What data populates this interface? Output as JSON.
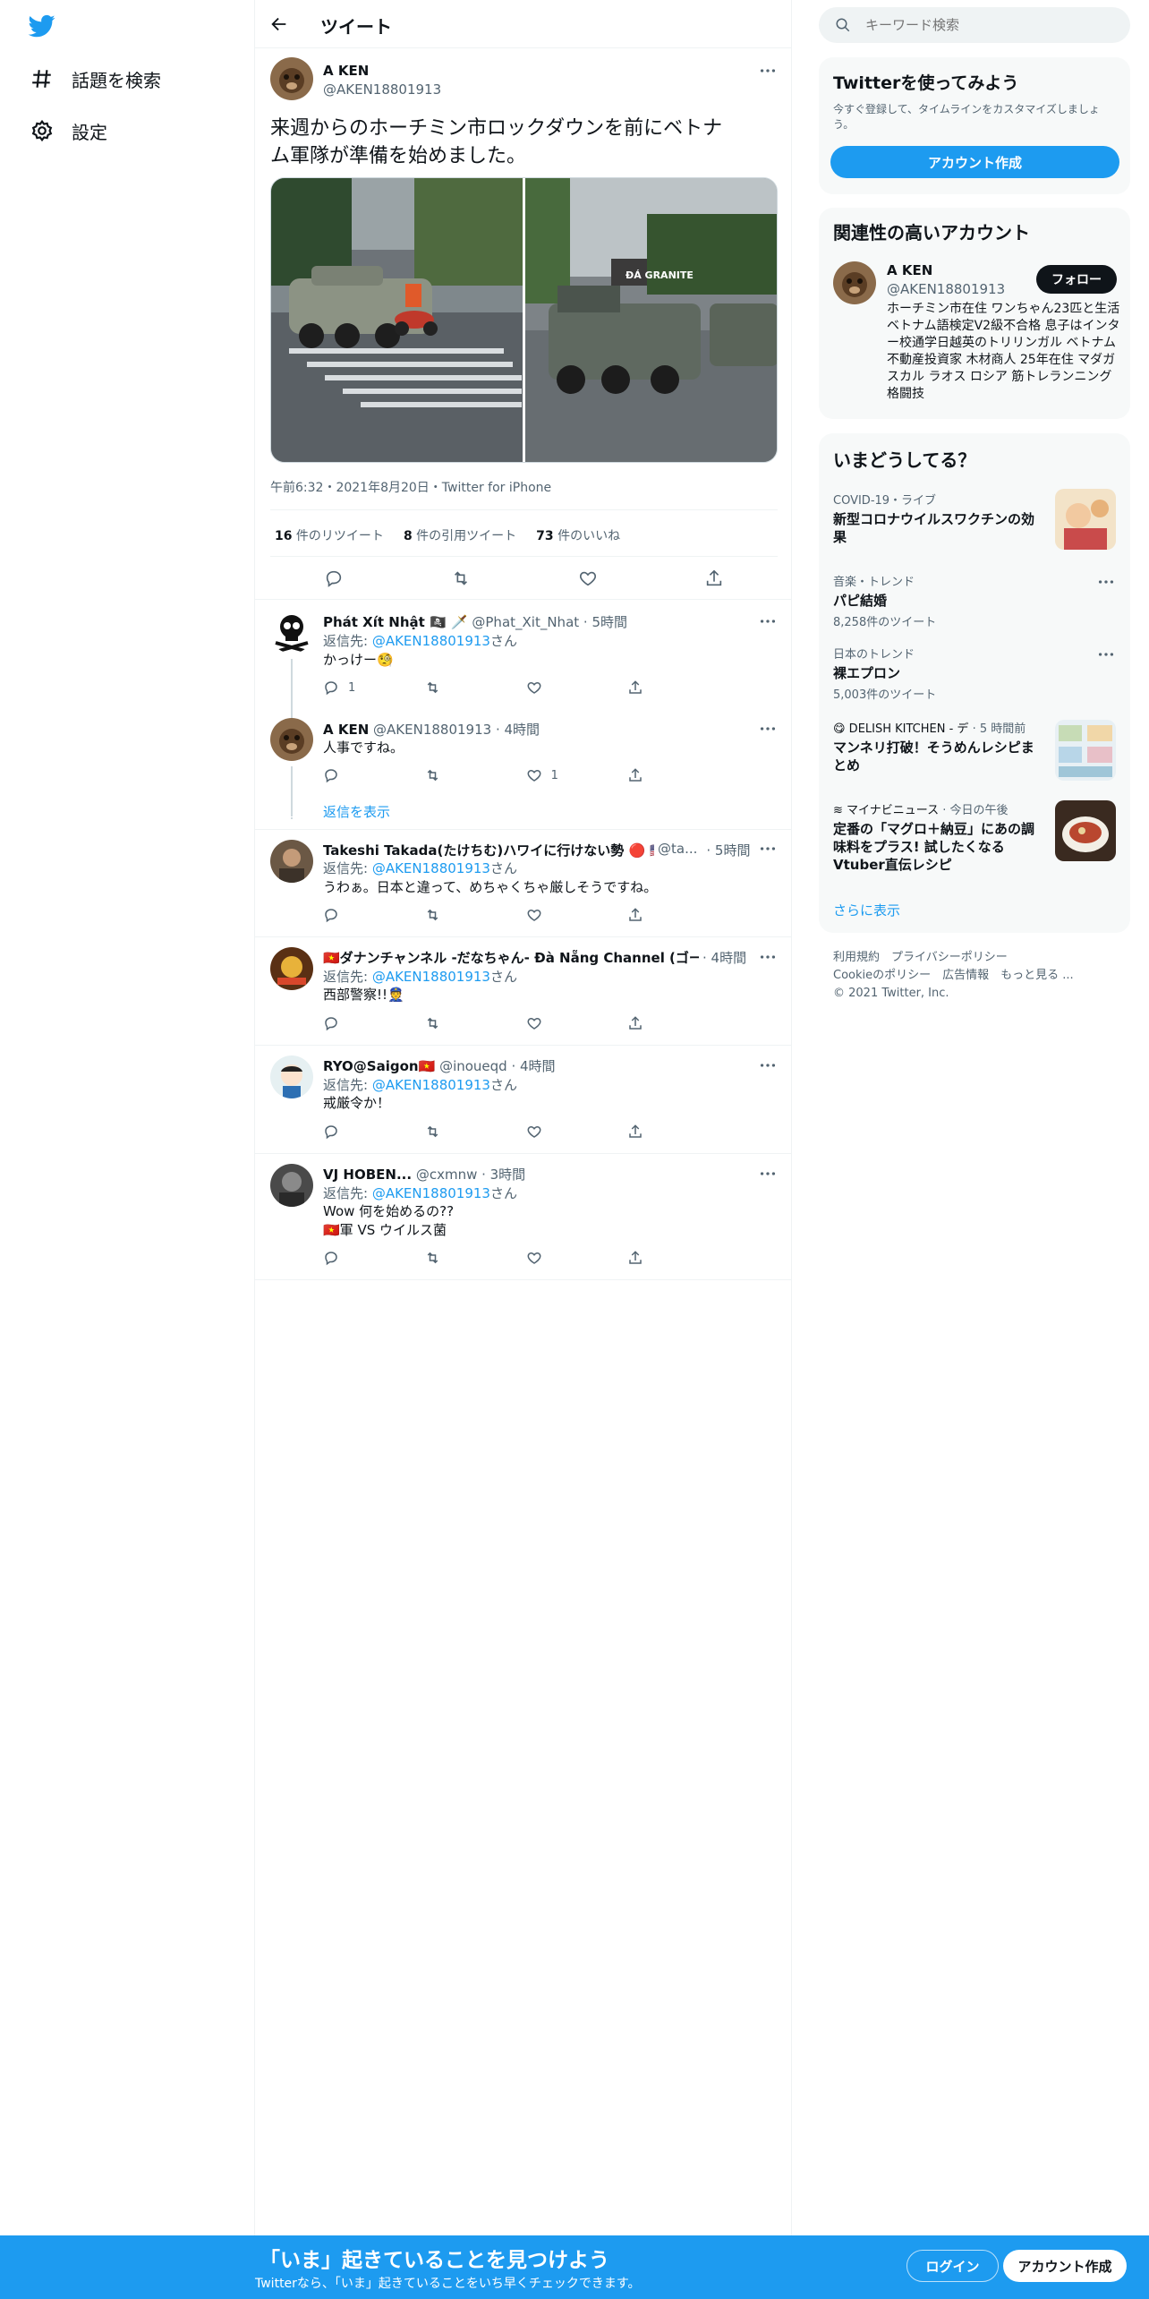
{
  "nav": {
    "logo": "twitter-bird-icon",
    "items": [
      {
        "label": "話題を検索",
        "icon": "hashtag-icon"
      },
      {
        "label": "設定",
        "icon": "gear-icon"
      }
    ]
  },
  "header": {
    "title": "ツイート"
  },
  "tweet": {
    "name": "A KEN",
    "handle": "@AKEN18801913",
    "text_line1": "来週からのホーチミン市ロックダウンを前にベトナ",
    "text_line2": "ム軍隊が準備を始めました。",
    "image_left_sign": "",
    "image_right_sign": "ĐÁ GRANITE",
    "timestamp": "午前6:32・2021年8月20日・Twitter for iPhone",
    "retweets_count": "16",
    "retweets_label": " 件のリツイート",
    "quotes_count": "8",
    "quotes_label": " 件の引用ツイート",
    "likes_count": "73",
    "likes_label": " 件のいいね"
  },
  "replies": [
    {
      "name": "Phát Xít Nhật 🏴‍☠️ 🗡️",
      "handle": "@Phat_Xit_Nhat · 5時間",
      "reply_to_label": "返信先: ",
      "reply_to": "@AKEN18801913",
      "reply_to_suffix": "さん",
      "text": "かっけー🧐",
      "reply_count": "1",
      "like_count": ""
    },
    {
      "name": "A KEN",
      "handle": "@AKEN18801913 · 4時間",
      "text": "人事ですね。",
      "like_count": "1",
      "show_replies": "返信を表示"
    },
    {
      "name": "Takeshi Takada(たけちむ)ハワイに行けない勢 🔴 🇺🇸🇵🇭",
      "handle": "@ta...",
      "time": "· 5時間",
      "reply_to_label": "返信先: ",
      "reply_to": "@AKEN18801913",
      "reply_to_suffix": "さん",
      "text": "うわぁ。日本と違って、めちゃくちゃ厳しそうですね。"
    },
    {
      "name": "🇻🇳ダナンチャンネル -だなちゃん- Đà Nẵng Channel (ゴーゴー",
      "time": "· 4時間",
      "reply_to_label": "返信先: ",
      "reply_to": "@AKEN18801913",
      "reply_to_suffix": "さん",
      "text": "西部警察!!👮"
    },
    {
      "name": "RYO@Saigon🇻🇳",
      "handle": "@inoueqd · 4時間",
      "reply_to_label": "返信先: ",
      "reply_to": "@AKEN18801913",
      "reply_to_suffix": "さん",
      "text": "戒厳令か！"
    },
    {
      "name": "VJ HOBEN...",
      "handle": "@cxmnw · 3時間",
      "reply_to_label": "返信先: ",
      "reply_to": "@AKEN18801913",
      "reply_to_suffix": "さん",
      "text": "Wow 何を始めるの??",
      "text2": "🇻🇳軍 VS ウイルス菌"
    }
  ],
  "search": {
    "placeholder": "キーワード検索"
  },
  "signup_card": {
    "title": "Twitterを使ってみよう",
    "desc": "今すぐ登録して、タイムラインをカスタマイズしましょう。",
    "button": "アカウント作成"
  },
  "related": {
    "title": "関連性の高いアカウント",
    "name": "A KEN",
    "handle": "@AKEN18801913",
    "follow": "フォロー",
    "bio": "ホーチミン市在住 ワンちゃん23匹と生活 ベトナム語検定V2級不合格 息子はインター校通学日越英のトリリンガル ベトナム不動産投資家 木材商人 25年在住 マダガスカル ラオス ロシア 筋トレランニング 格闘技"
  },
  "trends": {
    "title": "いまどうしてる？",
    "items": [
      {
        "category": "COVID-19・ライブ",
        "title": "新型コロナウイルスワクチンの効果",
        "count": ""
      },
      {
        "category": "音楽・トレンド",
        "title": "パピ結婚",
        "count": "8,258件のツイート"
      },
      {
        "category": "日本のトレンド",
        "title": "裸エプロン",
        "count": "5,003件のツイート"
      },
      {
        "category": "😋 DELISH KITCHEN - デ",
        "time": "· 5 時間前",
        "title": "マンネリ打破！そうめんレシピまとめ"
      },
      {
        "category": "≋ マイナビニュース",
        "time": "· 今日の午後",
        "title": "定番の「マグロ＋納豆」にあの調味料をプラス! 試したくなるVtuber直伝レシピ"
      }
    ],
    "show_more": "さらに表示"
  },
  "footer": {
    "line1": "利用規約　プライバシーポリシー",
    "line2": "Cookieのポリシー　広告情報　もっと見る ...",
    "line3": "© 2021 Twitter, Inc."
  },
  "bottom_bar": {
    "title": "「いま」起きていることを見つけよう",
    "subtitle": "Twitterなら、「いま」起きていることをいち早くチェックできます。",
    "login": "ログイン",
    "signup": "アカウント作成"
  },
  "colors": {
    "accent": "#1d9bf0",
    "text": "#0f1419",
    "muted": "#536471",
    "border": "#eff3f4"
  }
}
